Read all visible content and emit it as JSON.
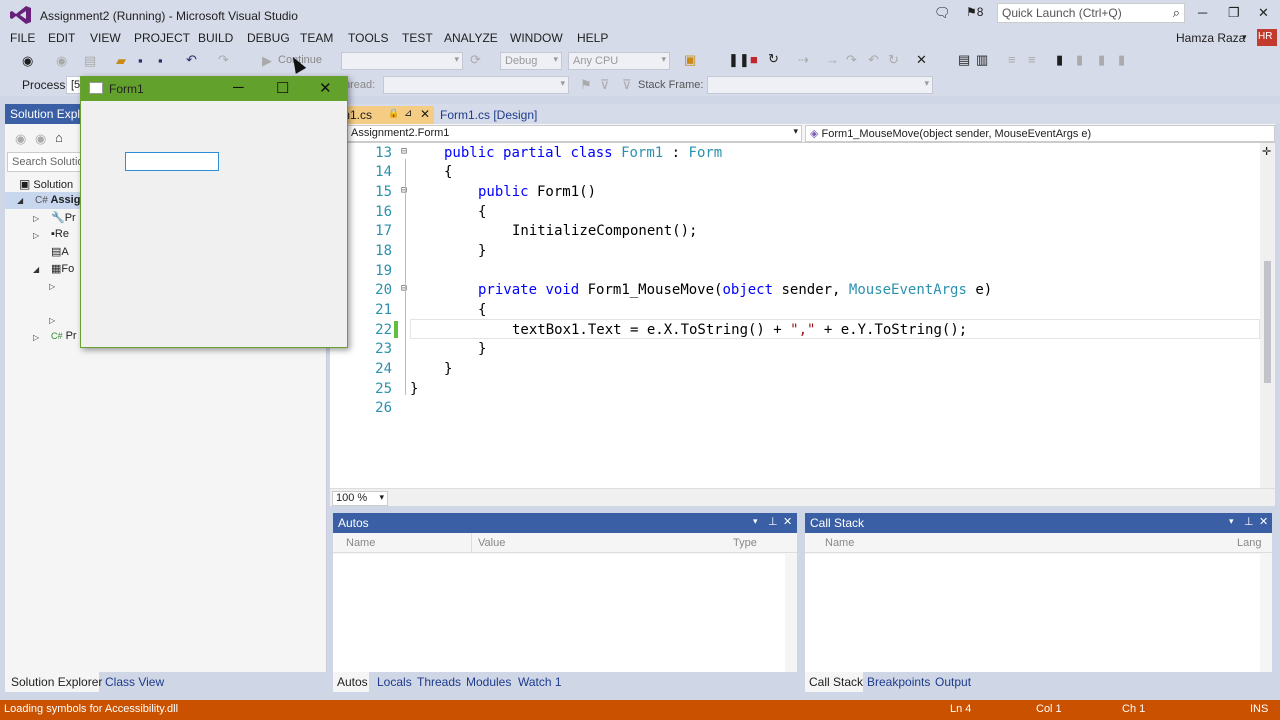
{
  "window": {
    "title": "Assignment2 (Running) - Microsoft Visual Studio",
    "notification_count": "8",
    "quick_launch_placeholder": "Quick Launch (Ctrl+Q)",
    "user": "Hamza Raza",
    "user_initials": "HR"
  },
  "menu": [
    "FILE",
    "EDIT",
    "VIEW",
    "PROJECT",
    "BUILD",
    "DEBUG",
    "TEAM",
    "TOOLS",
    "TEST",
    "ANALYZE",
    "WINDOW",
    "HELP"
  ],
  "toolbar": {
    "continue_label": "Continue",
    "configuration": "Debug",
    "platform": "Any CPU",
    "process_label": "Process:",
    "process_value": "[5",
    "thread_label": "hread:",
    "stack_frame_label": "Stack Frame:"
  },
  "solution_explorer": {
    "header": "Solution Explo",
    "search_placeholder": "Search Solution",
    "items": [
      {
        "label": "Solution"
      },
      {
        "label": "Assign"
      },
      {
        "label": "Pr"
      },
      {
        "label": "Re"
      },
      {
        "label": "A"
      },
      {
        "label": "Fo"
      },
      {
        "label": "Pr"
      }
    ],
    "tabs": [
      "Solution Explorer",
      "Class View"
    ]
  },
  "form1": {
    "title": "Form1",
    "textbox_value": ""
  },
  "doc_tabs": [
    {
      "label": "rm1.cs",
      "active": true
    },
    {
      "label": "Form1.cs [Design]",
      "active": false
    }
  ],
  "navbar": {
    "class_combo": "Assignment2.Form1",
    "member_combo": "Form1_MouseMove(object sender, MouseEventArgs e)"
  },
  "editor": {
    "line_numbers": [
      "13",
      "14",
      "15",
      "16",
      "17",
      "18",
      "19",
      "20",
      "21",
      "22",
      "23",
      "24",
      "25",
      "26"
    ],
    "zoom": "100 %"
  },
  "autos": {
    "title": "Autos",
    "columns": [
      "Name",
      "Value",
      "Type"
    ],
    "tabs": [
      "Autos",
      "Locals",
      "Threads",
      "Modules",
      "Watch 1"
    ]
  },
  "callstack": {
    "title": "Call Stack",
    "columns": [
      "Name",
      "Lang"
    ],
    "tabs": [
      "Call Stack",
      "Breakpoints",
      "Output"
    ]
  },
  "status": {
    "message": "Loading symbols for Accessibility.dll",
    "ln": "Ln 4",
    "col": "Col 1",
    "ch": "Ch 1",
    "mode": "INS"
  },
  "colors": {
    "status_bar": "#ca5100",
    "tool_header": "#3a5fa5",
    "form_titlebar": "#63a12d",
    "keyword": "#0000ff",
    "type": "#2b91af",
    "string": "#a31515"
  }
}
